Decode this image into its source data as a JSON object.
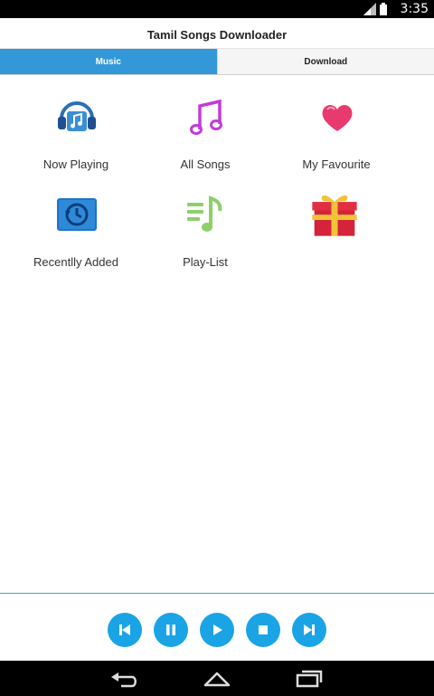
{
  "status": {
    "time": "3:35"
  },
  "app": {
    "title": "Tamil Songs Downloader"
  },
  "tabs": [
    {
      "label": "Music",
      "active": true
    },
    {
      "label": "Download",
      "active": false
    }
  ],
  "grid": [
    {
      "label": "Now Playing",
      "icon": "headphones-music-icon"
    },
    {
      "label": "All Songs",
      "icon": "music-note-icon"
    },
    {
      "label": "My Favourite",
      "icon": "heart-icon"
    },
    {
      "label": "Recentlly Added",
      "icon": "history-clock-icon"
    },
    {
      "label": "Play-List",
      "icon": "playlist-icon"
    },
    {
      "label": "",
      "icon": "gift-icon"
    }
  ],
  "player": {
    "buttons": [
      "previous-icon",
      "pause-icon",
      "play-icon",
      "stop-icon",
      "next-icon"
    ]
  },
  "colors": {
    "accent": "#3398d8",
    "player_button": "#1aa4e6"
  }
}
